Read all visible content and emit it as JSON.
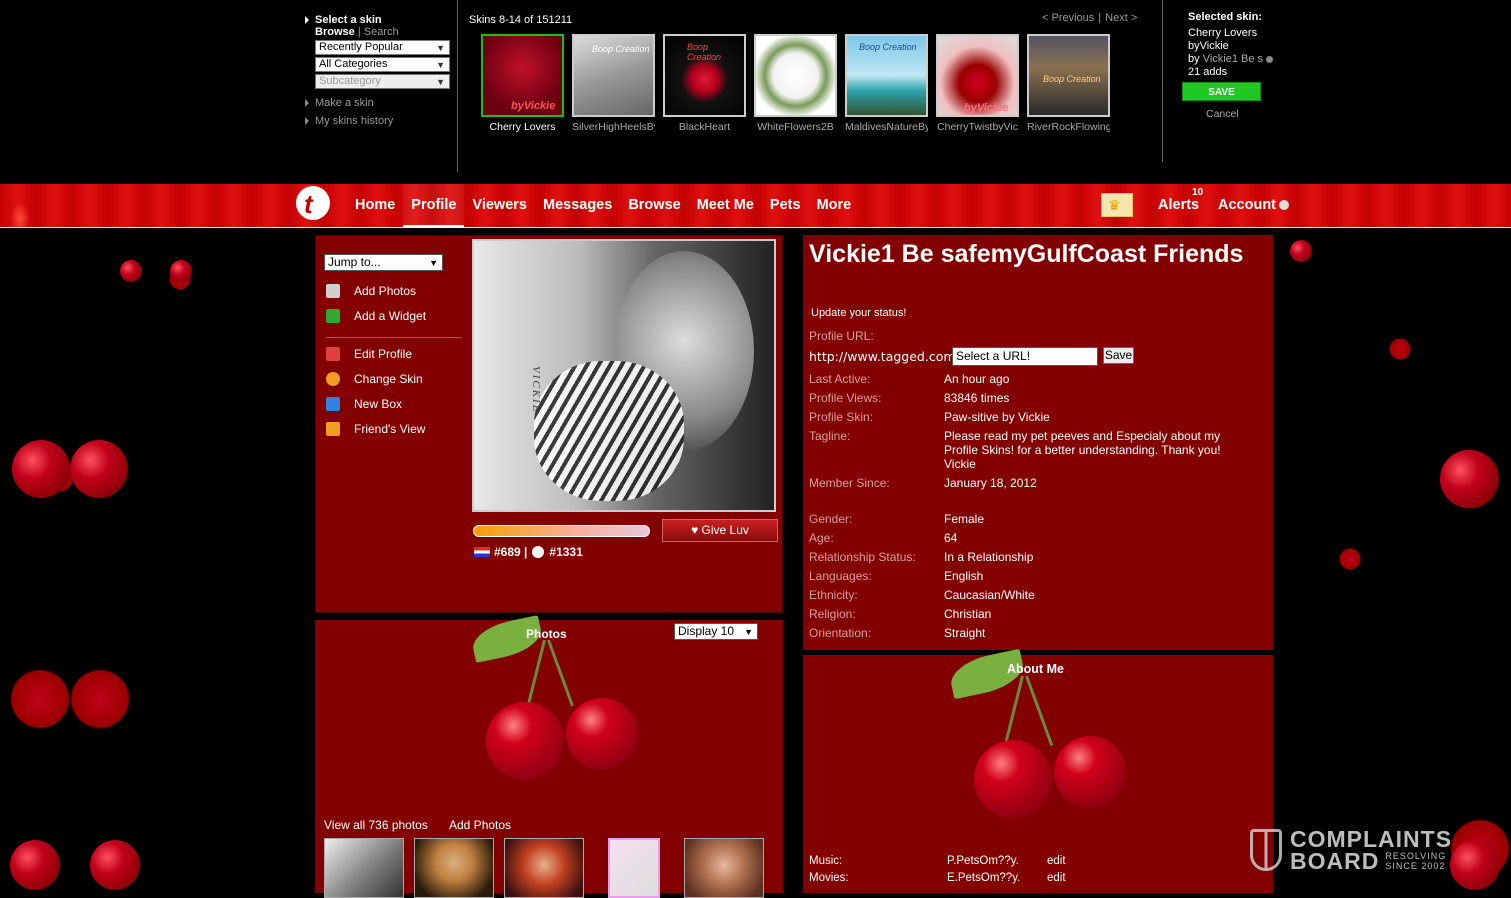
{
  "skin_picker": {
    "select_title": "Select a skin",
    "browse": "Browse",
    "separator": "|",
    "search": "Search",
    "sort_value": "Recently Popular",
    "category_value": "All Categories",
    "subcategory_placeholder": "Subcategory",
    "make_skin": "Make a skin",
    "history": "My skins history",
    "count_text": "Skins 8-14 of 151211",
    "prev": "< Previous",
    "next": "Next >",
    "nav_sep": "|",
    "thumbs": [
      {
        "caption": "Cherry Lovers",
        "overlay": "byVickie",
        "selected": true
      },
      {
        "caption": "SilverHighHeelsBy",
        "overlay": "Boop Creation",
        "selected": false
      },
      {
        "caption": "BlackHeart",
        "overlay": "Boop Creation",
        "selected": false
      },
      {
        "caption": "WhiteFlowers2B",
        "overlay": "",
        "selected": false
      },
      {
        "caption": "MaldivesNatureBy",
        "overlay": "Boop Creation",
        "selected": false
      },
      {
        "caption": "CherryTwistbyVic",
        "overlay": "byVickie",
        "selected": false
      },
      {
        "caption": "RiverRockFlowing",
        "overlay": "Boop Creation",
        "selected": false
      }
    ],
    "selected": {
      "heading": "Selected skin:",
      "name": "Cherry Lovers",
      "by_line": "byVickie",
      "by_prefix": "by",
      "by_user": "Vickie1 Be s",
      "adds": "21 adds",
      "save": "SAVE",
      "cancel": "Cancel"
    }
  },
  "nav": {
    "items": [
      "Home",
      "Profile",
      "Viewers",
      "Messages",
      "Browse",
      "Meet Me",
      "Pets",
      "More"
    ],
    "active": "Profile",
    "alerts": "Alerts",
    "alert_count": "10",
    "account": "Account"
  },
  "left_menu": {
    "jump": "Jump to...",
    "items": [
      {
        "label": "Add Photos",
        "icon": "camera-icon",
        "color": "#cfcfcf"
      },
      {
        "label": "Add a Widget",
        "icon": "widget-icon",
        "color": "#2ea82e"
      },
      {
        "label": "Edit Profile",
        "icon": "pencil-icon",
        "color": "#e04040"
      },
      {
        "label": "Change Skin",
        "icon": "palette-icon",
        "color": "#f0a020"
      },
      {
        "label": "New Box",
        "icon": "plus-box-icon",
        "color": "#2f80e0"
      },
      {
        "label": "Friend's View",
        "icon": "friend-view-icon",
        "color": "#f0a020"
      }
    ]
  },
  "profile_photo": {
    "caption": "VICKIE"
  },
  "luv": {
    "give": "Give Luv",
    "level": 0.5
  },
  "ranks": {
    "country": "#689",
    "sep": "|",
    "global": "#1331"
  },
  "photos": {
    "title": "Photos",
    "display": "Display 10",
    "view_all": "View all 736 photos",
    "add": "Add Photos"
  },
  "profile": {
    "name": "Vickie1 Be safemyGulfCoast Friends",
    "status_link": "Update your status!",
    "url_label": "Profile URL:",
    "url_prefix": "http://www.tagged.com/",
    "url_placeholder": "Select a URL!",
    "url_save": "Save",
    "fields": [
      {
        "k": "Last Active:",
        "v": "An hour ago"
      },
      {
        "k": "Profile Views:",
        "v": "83846 times"
      },
      {
        "k": "Profile Skin:",
        "v": "Paw-sitive by Vickie"
      },
      {
        "k": "Tagline:",
        "v": "Please read my pet peeves and Especialy about my Profile Skins! for a better understanding. Thank you! Vickie"
      },
      {
        "k": "Member Since:",
        "v": "January 18, 2012"
      }
    ],
    "fields2": [
      {
        "k": "Gender:",
        "v": "Female"
      },
      {
        "k": "Age:",
        "v": "64"
      },
      {
        "k": "Relationship Status:",
        "v": "In a Relationship"
      },
      {
        "k": "Languages:",
        "v": "English"
      },
      {
        "k": "Ethnicity:",
        "v": "Caucasian/White"
      },
      {
        "k": "Religion:",
        "v": "Christian"
      },
      {
        "k": "Orientation:",
        "v": "Straight"
      }
    ]
  },
  "about": {
    "title": "About Me",
    "rows": [
      {
        "k": "Music:",
        "v": "P.PetsOm??y.",
        "edit": "edit"
      },
      {
        "k": "Movies:",
        "v": "E.PetsOm??y.",
        "edit": "edit"
      }
    ]
  },
  "watermark": {
    "line1a": "COMPLAINTS",
    "line1b": "BOARD",
    "line2a": "RESOLVING",
    "line2b": "SINCE 2002"
  }
}
